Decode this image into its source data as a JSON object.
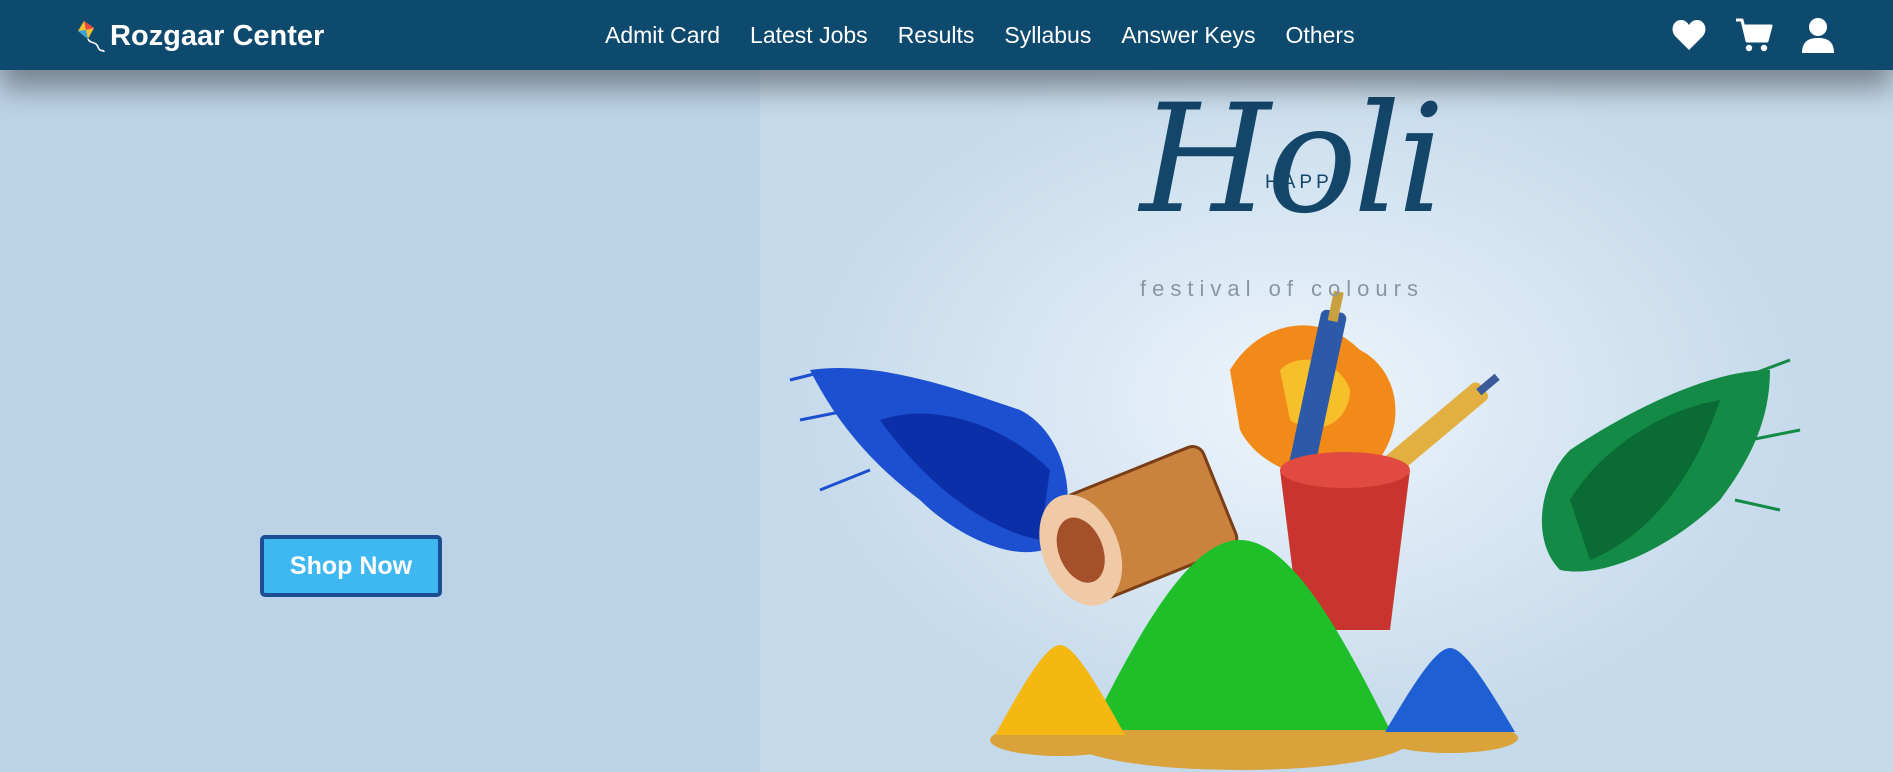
{
  "brand": {
    "name": "Rozgaar Center",
    "logo_icon": "kite-icon"
  },
  "nav": {
    "links": [
      {
        "label": "Admit Card"
      },
      {
        "label": "Latest Jobs"
      },
      {
        "label": "Results"
      },
      {
        "label": "Syllabus"
      },
      {
        "label": "Answer Keys"
      },
      {
        "label": "Others"
      }
    ]
  },
  "header_icons": {
    "wishlist": "heart-icon",
    "cart": "cart-icon",
    "account": "user-icon"
  },
  "hero": {
    "button_label": "Shop Now",
    "banner": {
      "happy": "HAPPY",
      "title": "Holi",
      "subtitle": "festival of colours"
    }
  },
  "colors": {
    "navbar": "#0d4a6e",
    "hero_background": "#bcd2e6",
    "button_fill": "#3fb7f0",
    "button_border": "#1d4e93"
  }
}
